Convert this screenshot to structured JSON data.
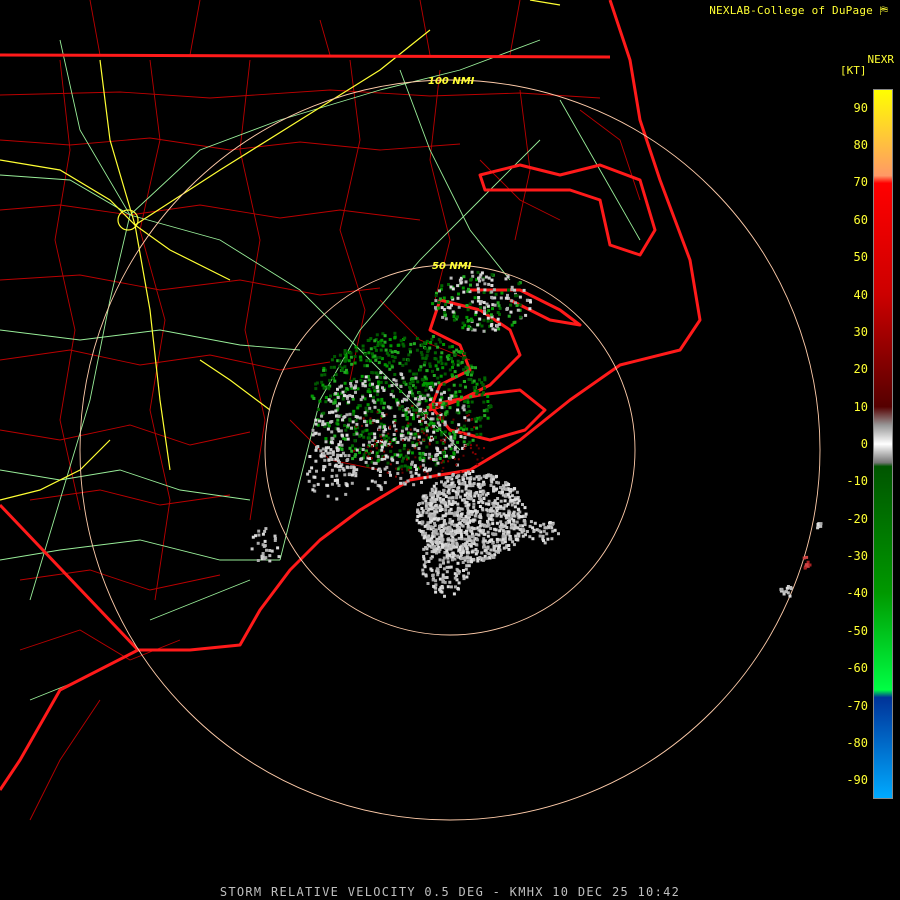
{
  "header": {
    "credit": "NEXLAB-College of DuPage",
    "product": "NEXR",
    "unit": "[KT]"
  },
  "range_rings": {
    "inner_label": "50 NMI",
    "outer_label": "100 NMI"
  },
  "legend": {
    "ticks": [
      "90",
      "80",
      "70",
      "60",
      "50",
      "40",
      "30",
      "20",
      "10",
      "0",
      "-10",
      "-20",
      "-30",
      "-40",
      "-50",
      "-60",
      "-70",
      "-80",
      "-90"
    ],
    "tick_values": [
      90,
      80,
      70,
      60,
      50,
      40,
      30,
      20,
      10,
      0,
      -10,
      -20,
      -30,
      -40,
      -50,
      -60,
      -70,
      -80,
      -90
    ],
    "range": [
      -95,
      95
    ],
    "stops": [
      {
        "value": 95,
        "color": "#ffff00"
      },
      {
        "value": 72,
        "color": "#ff9966"
      },
      {
        "value": 70,
        "color": "#ff0000"
      },
      {
        "value": 40,
        "color": "#cc0000"
      },
      {
        "value": 10,
        "color": "#550000"
      },
      {
        "value": 5,
        "color": "#999999"
      },
      {
        "value": 0,
        "color": "#ffffff"
      },
      {
        "value": -5,
        "color": "#777777"
      },
      {
        "value": -6,
        "color": "#005500"
      },
      {
        "value": -40,
        "color": "#009900"
      },
      {
        "value": -66,
        "color": "#00ff44"
      },
      {
        "value": -68,
        "color": "#003399"
      },
      {
        "value": -95,
        "color": "#00aaff"
      }
    ]
  },
  "colors": {
    "state_border": "#ff1a1a",
    "county_line": "#cc0000",
    "highway_major": "#ffff33",
    "highway_minor": "#99ee99",
    "range_ring": "#ffccaa",
    "ring_label": "#ffff33"
  },
  "footer": {
    "text": "STORM RELATIVE VELOCITY 0.5 DEG - KMHX 10 DEC 25 10:42"
  }
}
